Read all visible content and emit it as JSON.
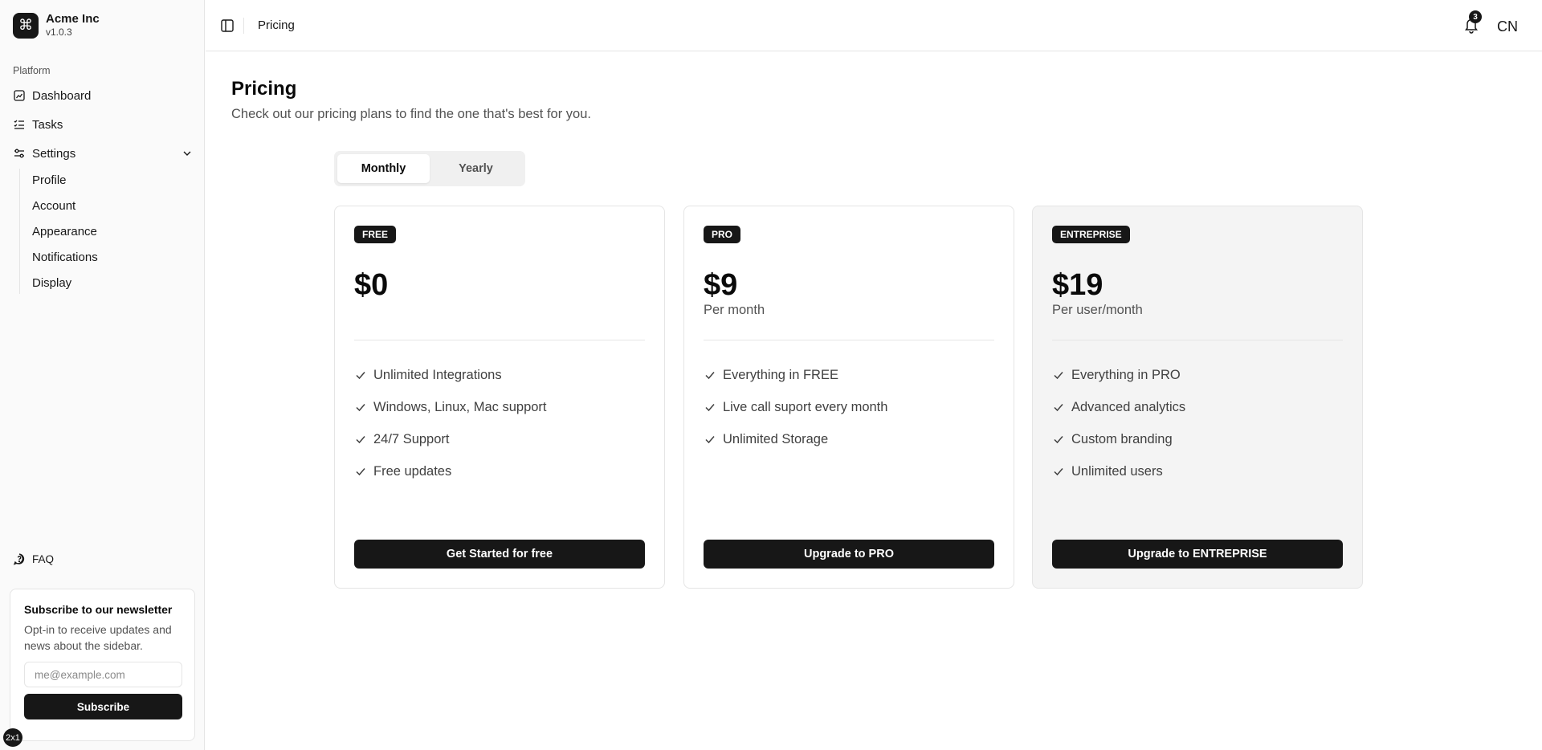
{
  "brand": {
    "name": "Acme Inc",
    "version": "v1.0.3",
    "logo_icon": "command-icon"
  },
  "sidebar": {
    "group_label": "Platform",
    "items": [
      {
        "label": "Dashboard",
        "icon": "dashboard-icon"
      },
      {
        "label": "Tasks",
        "icon": "list-checks-icon"
      },
      {
        "label": "Settings",
        "icon": "settings-sliders-icon",
        "expanded": true
      }
    ],
    "settings_sub": [
      "Profile",
      "Account",
      "Appearance",
      "Notifications",
      "Display"
    ],
    "faq_label": "FAQ",
    "newsletter": {
      "title": "Subscribe to our newsletter",
      "description": "Opt-in to receive updates and news about the sidebar.",
      "placeholder": "me@example.com",
      "button": "Subscribe"
    },
    "zoom_badge": "2x1"
  },
  "header": {
    "breadcrumb": "Pricing",
    "notification_count": "3",
    "avatar_initials": "CN"
  },
  "main": {
    "title": "Pricing",
    "subtitle": "Check out our pricing plans to find the one that's best for you.",
    "billing_toggle": {
      "options": [
        "Monthly",
        "Yearly"
      ],
      "selected": "Monthly"
    },
    "plans": [
      {
        "tier": "FREE",
        "price": "$0",
        "period": "",
        "features": [
          "Unlimited Integrations",
          "Windows, Linux, Mac support",
          "24/7 Support",
          "Free updates"
        ],
        "cta": "Get Started for free",
        "highlighted": false
      },
      {
        "tier": "PRO",
        "price": "$9",
        "period": "Per month",
        "features": [
          "Everything in FREE",
          "Live call suport every month",
          "Unlimited Storage"
        ],
        "cta": "Upgrade to PRO",
        "highlighted": false
      },
      {
        "tier": "ENTREPRISE",
        "price": "$19",
        "period": "Per user/month",
        "features": [
          "Everything in PRO",
          "Advanced analytics",
          "Custom branding",
          "Unlimited users"
        ],
        "cta": "Upgrade to ENTREPRISE",
        "highlighted": true
      }
    ]
  },
  "colors": {
    "primary": "#171717",
    "muted_text": "#525252",
    "border": "#e5e5e5",
    "highlight_card": "#f4f4f4"
  }
}
